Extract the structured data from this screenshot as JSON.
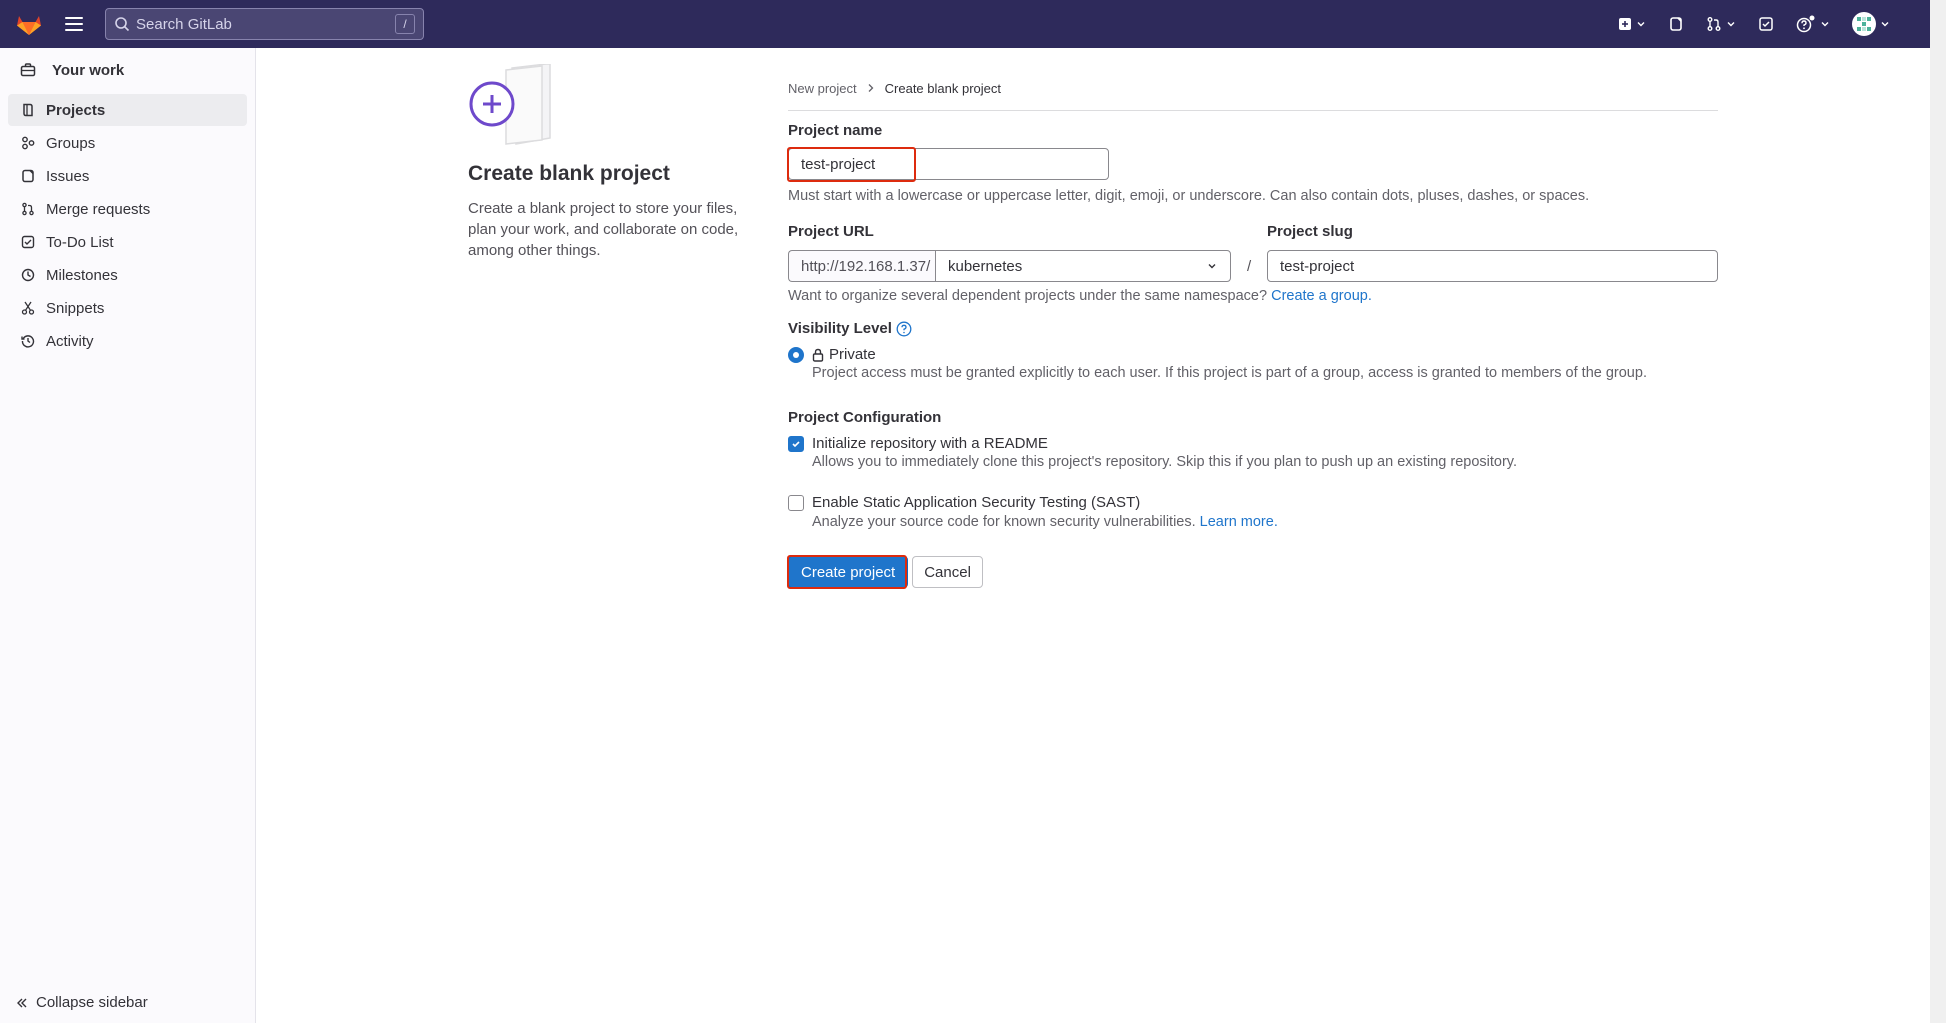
{
  "topbar": {
    "search_placeholder": "Search GitLab",
    "search_shortcut": "/"
  },
  "sidebar": {
    "header": "Your work",
    "items": [
      {
        "label": "Projects",
        "icon": "project-icon",
        "active": true
      },
      {
        "label": "Groups",
        "icon": "group-icon"
      },
      {
        "label": "Issues",
        "icon": "issues-icon"
      },
      {
        "label": "Merge requests",
        "icon": "merge-request-icon"
      },
      {
        "label": "To-Do List",
        "icon": "todo-icon"
      },
      {
        "label": "Milestones",
        "icon": "milestone-icon"
      },
      {
        "label": "Snippets",
        "icon": "snippet-icon"
      },
      {
        "label": "Activity",
        "icon": "history-icon"
      }
    ],
    "collapse_label": "Collapse sidebar"
  },
  "info": {
    "title": "Create blank project",
    "description": "Create a blank project to store your files, plan your work, and collaborate on code, among other things."
  },
  "breadcrumb": {
    "parent": "New project",
    "current": "Create blank project"
  },
  "form": {
    "project_name_label": "Project name",
    "project_name_value": "test-project",
    "project_name_help": "Must start with a lowercase or uppercase letter, digit, emoji, or underscore. Can also contain dots, pluses, dashes, or spaces.",
    "project_url_label": "Project URL",
    "project_url_prefix": "http://192.168.1.37/",
    "namespace_value": "kubernetes",
    "url_separator": "/",
    "project_slug_label": "Project slug",
    "project_slug_value": "test-project",
    "namespace_help": "Want to organize several dependent projects under the same namespace?",
    "namespace_help_link": "Create a group.",
    "visibility_label": "Visibility Level",
    "visibility_option": "Private",
    "visibility_help": "Project access must be granted explicitly to each user. If this project is part of a group, access is granted to members of the group.",
    "config_label": "Project Configuration",
    "readme_label": "Initialize repository with a README",
    "readme_help": "Allows you to immediately clone this project's repository. Skip this if you plan to push up an existing repository.",
    "sast_label": "Enable Static Application Security Testing (SAST)",
    "sast_help": "Analyze your source code for known security vulnerabilities.",
    "sast_help_link": "Learn more.",
    "create_button": "Create project",
    "cancel_button": "Cancel"
  },
  "colors": {
    "topbar": "#2e2a5b",
    "primary": "#1f75cb",
    "highlight": "#dd2b0e"
  }
}
